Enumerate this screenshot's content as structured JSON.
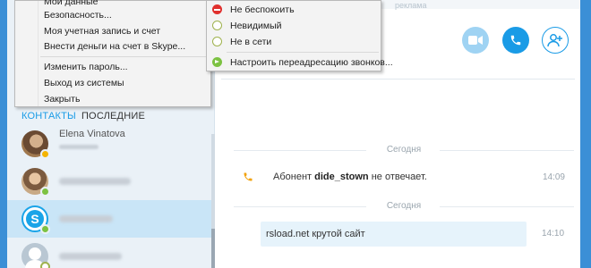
{
  "colors": {
    "frame": "#3b8fd6",
    "accent": "#1a9be6",
    "sidebar_bg": "#eaf1f7",
    "selected_bg": "#c9e5f7",
    "bubble_bg": "#e6f3fb"
  },
  "app_menu": {
    "cut_top_label": "Мои данные",
    "items": [
      {
        "label": "Безопасность...",
        "icon": ""
      },
      {
        "label": "Моя учетная запись и счет",
        "icon": ""
      },
      {
        "label": "Внести деньги на счет в Skype...",
        "icon": ""
      },
      {
        "label": "Изменить пароль...",
        "icon": ""
      },
      {
        "label": "Выход из системы",
        "icon": ""
      },
      {
        "label": "Закрыть",
        "icon": ""
      }
    ]
  },
  "status_menu": {
    "items": [
      {
        "label": "Не беспокоить",
        "icon": "do-not-disturb-icon"
      },
      {
        "label": "Невидимый",
        "icon": "invisible-status-icon"
      },
      {
        "label": "Не в сети",
        "icon": "offline-status-icon"
      },
      {
        "label": "Настроить переадресацию звонков...",
        "icon": "call-forward-icon"
      }
    ]
  },
  "sidebar": {
    "tabs": [
      {
        "label": "КОНТАКТЫ",
        "active": true
      },
      {
        "label": "ПОСЛЕДНИЕ",
        "active": false
      }
    ],
    "contacts": [
      {
        "name": "Elena Vinatova",
        "status": "away"
      },
      {
        "name": "",
        "status": "online"
      },
      {
        "name": "",
        "status": "online",
        "selected": true
      },
      {
        "name": "",
        "status": "offline"
      }
    ]
  },
  "main": {
    "header_hint": "реклама",
    "buttons": {
      "video": "video-call-icon",
      "audio": "audio-call-icon",
      "add": "add-person-icon"
    },
    "day_separator_1": "Сегодня",
    "day_separator_2": "Сегодня",
    "missed_call": {
      "prefix": "Абонент",
      "user": "dide_stown",
      "suffix": "не отвечает.",
      "time": "14:09"
    },
    "message": {
      "text": "rsload.net крутой сайт",
      "time": "14:10"
    }
  }
}
